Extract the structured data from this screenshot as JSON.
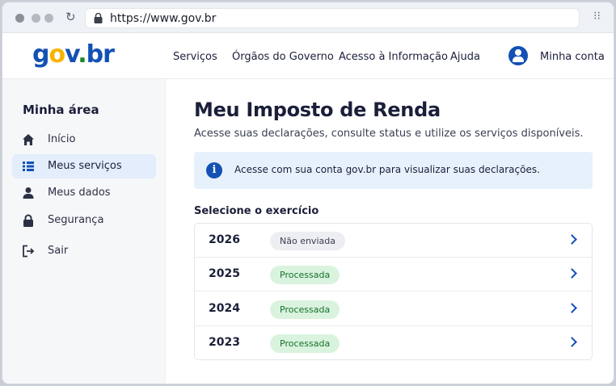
{
  "browser": {
    "url": "https://www.gov.br"
  },
  "header": {
    "logo": {
      "g": "g",
      "o": "o",
      "v": "v",
      "dot": ".",
      "br": "br"
    },
    "nav": [
      "Serviços",
      "Órgãos do Governo",
      "Acesso à Informação",
      "Ajuda"
    ],
    "account_label": "Minha conta"
  },
  "sidebar": {
    "title": "Minha área",
    "items": [
      {
        "label": "Início",
        "icon": "home-icon",
        "active": false
      },
      {
        "label": "Meus serviços",
        "icon": "list-icon",
        "active": true
      },
      {
        "label": "Meus dados",
        "icon": "person-icon",
        "active": false
      },
      {
        "label": "Segurança",
        "icon": "lock-icon",
        "active": false
      },
      {
        "label": "Sair",
        "icon": "logout-icon",
        "active": false
      }
    ]
  },
  "main": {
    "title": "Meu Imposto de Renda",
    "subtitle": "Acesse suas declarações, consulte status e utilize os serviços disponíveis.",
    "alert": "Acesse com sua conta gov.br para visualizar suas declarações.",
    "section_title": "Selecione o exercício",
    "years": [
      {
        "year": "2026",
        "status": "Não enviada",
        "state": "pending"
      },
      {
        "year": "2025",
        "status": "Processada",
        "state": "ok"
      },
      {
        "year": "2024",
        "status": "Processada",
        "state": "ok"
      },
      {
        "year": "2023",
        "status": "Processada",
        "state": "ok"
      }
    ]
  },
  "colors": {
    "primary": "#1351b4",
    "success": "#168821",
    "accent": "#f5b400"
  }
}
